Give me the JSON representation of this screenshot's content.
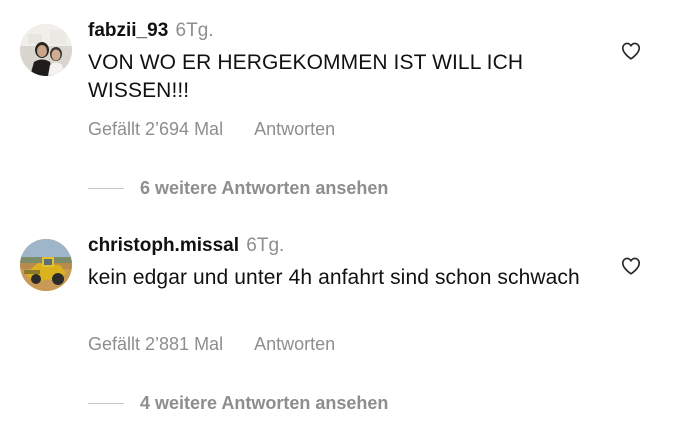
{
  "colors": {
    "text": "#111111",
    "secondary": "#8e8e8e",
    "divider": "#c7c7c7",
    "background": "#ffffff"
  },
  "comments": [
    {
      "username": "fabzii_93",
      "timestamp": "6Tg.",
      "text": "VON WO ER HERGEKOMMEN IST WILL ICH WISSEN!!!",
      "likes": "Gefällt 2’694 Mal",
      "reply_label": "Antworten",
      "more_replies": "6 weitere Antworten ansehen",
      "avatar_icon": "profile-photo",
      "like_icon": "heart-outline-icon"
    },
    {
      "username": "christoph.missal",
      "timestamp": "6Tg.",
      "text": "kein edgar und unter 4h anfahrt sind schon schwach",
      "likes": "Gefällt 2’881 Mal",
      "reply_label": "Antworten",
      "more_replies": "4 weitere Antworten ansehen",
      "avatar_icon": "profile-photo",
      "like_icon": "heart-outline-icon"
    }
  ]
}
